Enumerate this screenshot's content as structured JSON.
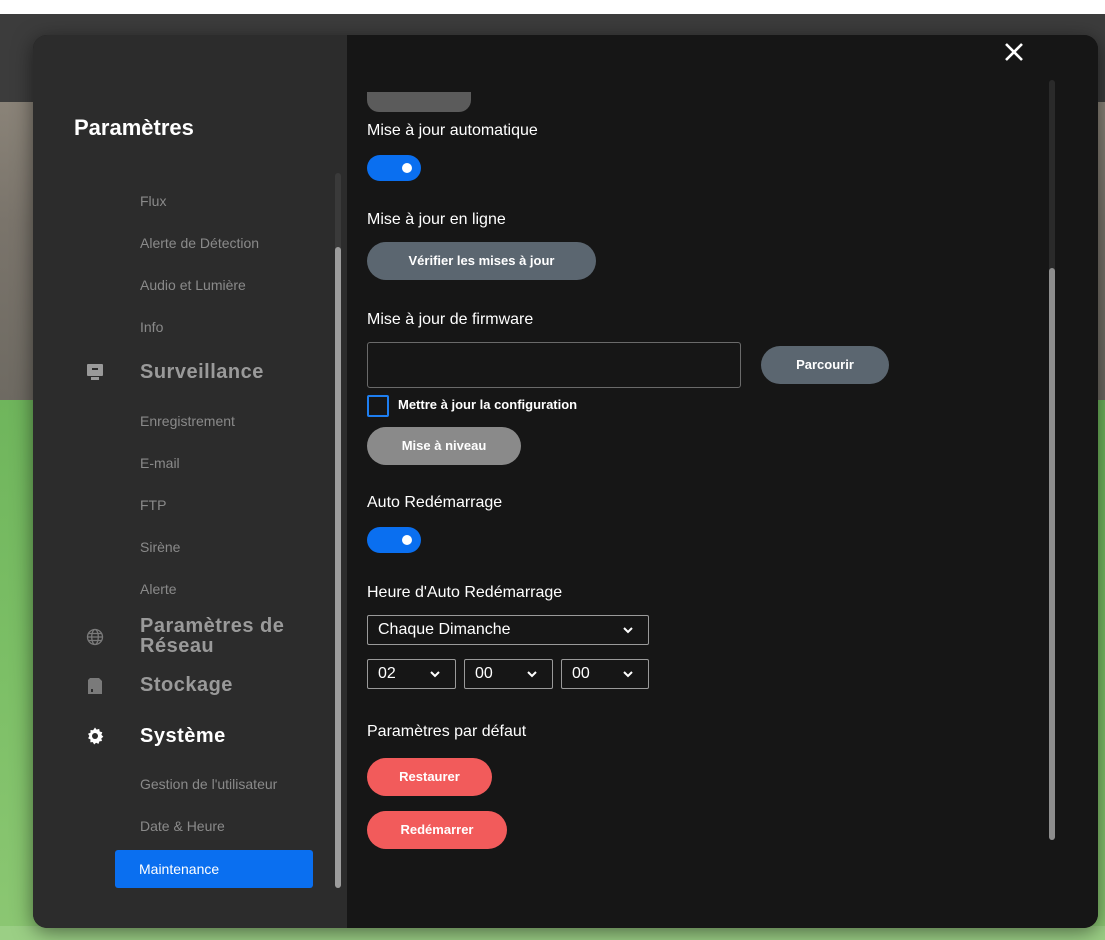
{
  "sidebar": {
    "title": "Paramètres",
    "items": [
      {
        "label": "Flux"
      },
      {
        "label": "Alerte de Détection"
      },
      {
        "label": "Audio et Lumière"
      },
      {
        "label": "Info"
      },
      {
        "label": "Surveillance",
        "icon": "monitor-icon"
      },
      {
        "label": "Enregistrement"
      },
      {
        "label": "E-mail"
      },
      {
        "label": "FTP"
      },
      {
        "label": "Sirène"
      },
      {
        "label": "Alerte"
      },
      {
        "label": "Paramètres de Réseau",
        "icon": "globe-icon"
      },
      {
        "label": "Stockage",
        "icon": "sd-card-icon"
      },
      {
        "label": "Système",
        "icon": "gear-icon"
      },
      {
        "label": "Gestion de l'utilisateur"
      },
      {
        "label": "Date & Heure"
      },
      {
        "label": "Maintenance",
        "active": true
      }
    ]
  },
  "main": {
    "auto_update": {
      "label": "Mise à jour automatique",
      "enabled": true
    },
    "online_update": {
      "label": "Mise à jour en ligne",
      "button": "Vérifier les mises à jour"
    },
    "firmware": {
      "label": "Mise à jour de firmware",
      "value": "",
      "browse_button": "Parcourir",
      "update_config_label": "Mettre à jour la configuration",
      "update_config_checked": false,
      "upgrade_button": "Mise à niveau"
    },
    "auto_reboot": {
      "label": "Auto Redémarrage",
      "enabled": true
    },
    "reboot_time": {
      "label": "Heure d'Auto Redémarrage",
      "day": "Chaque Dimanche",
      "hour": "02",
      "minute": "00",
      "second": "00"
    },
    "defaults": {
      "label": "Paramètres par défaut",
      "restore_button": "Restaurer",
      "reboot_button": "Redémarrer"
    }
  },
  "colors": {
    "accent": "#0a6ff0",
    "danger": "#f25b5b",
    "sidebar_bg": "#2c2c2c",
    "content_bg": "#161616"
  }
}
